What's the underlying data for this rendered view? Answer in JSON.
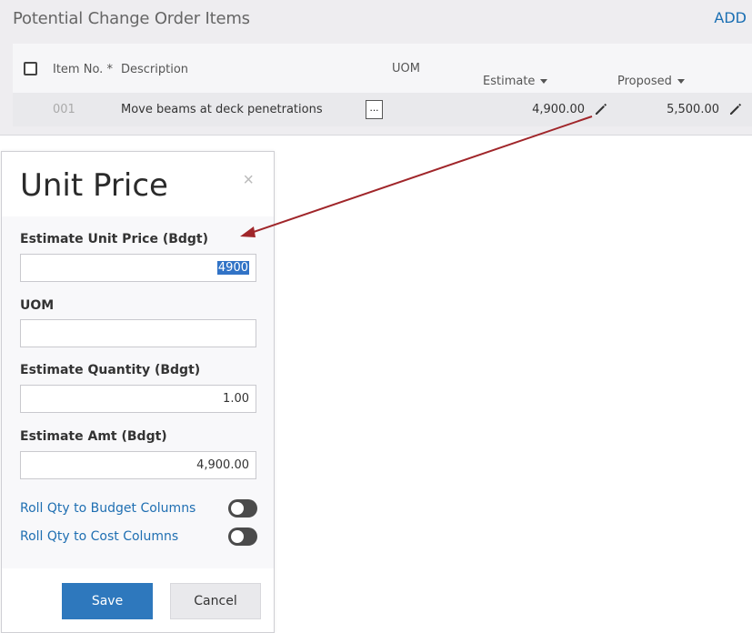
{
  "panel": {
    "title": "Potential Change Order Items",
    "add_label": "ADD",
    "columns": {
      "item_no": "Item No. *",
      "description": "Description",
      "uom": "UOM",
      "estimate": "Estimate",
      "proposed": "Proposed"
    },
    "row": {
      "item_no": "001",
      "description": "Move beams at deck penetrations",
      "uom_button": "...",
      "estimate": "4,900.00",
      "proposed": "5,500.00"
    }
  },
  "modal": {
    "title": "Unit Price",
    "close_glyph": "×",
    "fields": {
      "estimate_unit_price_label": "Estimate Unit Price (Bdgt)",
      "estimate_unit_price_value": "4900",
      "uom_label": "UOM",
      "uom_value": "",
      "estimate_quantity_label": "Estimate Quantity (Bdgt)",
      "estimate_quantity_value": "1.00",
      "estimate_amt_label": "Estimate Amt (Bdgt)",
      "estimate_amt_value": "4,900.00"
    },
    "toggles": {
      "roll_budget_label": "Roll Qty to Budget Columns",
      "roll_budget_on": false,
      "roll_cost_label": "Roll Qty to Cost Columns",
      "roll_cost_on": false
    },
    "buttons": {
      "save": "Save",
      "cancel": "Cancel"
    }
  },
  "colors": {
    "accent_blue": "#2e78bd",
    "link_blue": "#1a6fb3",
    "annotation_arrow": "#a0262a"
  },
  "icons": {
    "edit": "pencil-icon",
    "sort": "caret-down-icon",
    "close": "close-icon"
  }
}
